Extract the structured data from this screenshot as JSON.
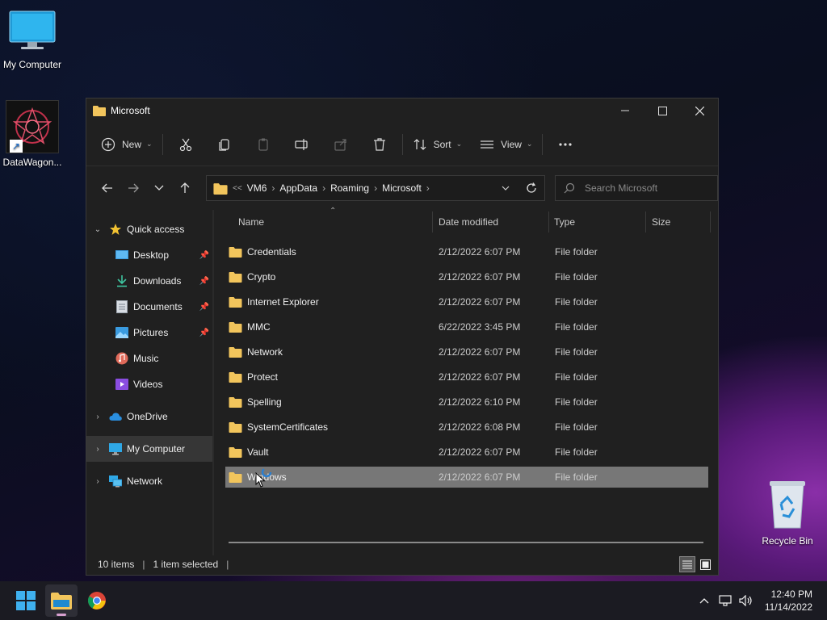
{
  "desktop": {
    "icons": [
      {
        "label": "My Computer"
      },
      {
        "label": "DataWagon..."
      },
      {
        "label": "Recycle Bin"
      }
    ]
  },
  "window": {
    "title": "Microsoft",
    "toolbar": {
      "new_label": "New",
      "sort_label": "Sort",
      "view_label": "View"
    },
    "address": {
      "overflow": "<<",
      "crumbs": [
        "VM6",
        "AppData",
        "Roaming",
        "Microsoft"
      ]
    },
    "search": {
      "placeholder": "Search Microsoft"
    },
    "sidebar": {
      "items": [
        {
          "label": "Quick access",
          "icon": "star-icon"
        },
        {
          "label": "Desktop",
          "icon": "desktop-icon",
          "pinned": true
        },
        {
          "label": "Downloads",
          "icon": "download-icon",
          "pinned": true
        },
        {
          "label": "Documents",
          "icon": "documents-icon",
          "pinned": true
        },
        {
          "label": "Pictures",
          "icon": "pictures-icon",
          "pinned": true
        },
        {
          "label": "Music",
          "icon": "music-icon"
        },
        {
          "label": "Videos",
          "icon": "videos-icon"
        },
        {
          "label": "OneDrive",
          "icon": "cloud-icon"
        },
        {
          "label": "My Computer",
          "icon": "computer-icon",
          "selected": true
        },
        {
          "label": "Network",
          "icon": "network-icon"
        }
      ]
    },
    "columns": {
      "name": "Name",
      "date": "Date modified",
      "type": "Type",
      "size": "Size"
    },
    "files": [
      {
        "name": "Credentials",
        "date": "2/12/2022 6:07 PM",
        "type": "File folder"
      },
      {
        "name": "Crypto",
        "date": "2/12/2022 6:07 PM",
        "type": "File folder"
      },
      {
        "name": "Internet Explorer",
        "date": "2/12/2022 6:07 PM",
        "type": "File folder"
      },
      {
        "name": "MMC",
        "date": "6/22/2022 3:45 PM",
        "type": "File folder"
      },
      {
        "name": "Network",
        "date": "2/12/2022 6:07 PM",
        "type": "File folder"
      },
      {
        "name": "Protect",
        "date": "2/12/2022 6:07 PM",
        "type": "File folder"
      },
      {
        "name": "Spelling",
        "date": "2/12/2022 6:10 PM",
        "type": "File folder"
      },
      {
        "name": "SystemCertificates",
        "date": "2/12/2022 6:08 PM",
        "type": "File folder"
      },
      {
        "name": "Vault",
        "date": "2/12/2022 6:07 PM",
        "type": "File folder"
      },
      {
        "name": "Windows",
        "date": "2/12/2022 6:07 PM",
        "type": "File folder",
        "selected": true
      }
    ],
    "status": {
      "count": "10 items",
      "selection": "1 item selected"
    }
  },
  "taskbar": {
    "clock_time": "12:40 PM",
    "clock_date": "11/14/2022"
  },
  "colors": {
    "folder": "#f2c55c",
    "accent": "#4cc2ff"
  }
}
